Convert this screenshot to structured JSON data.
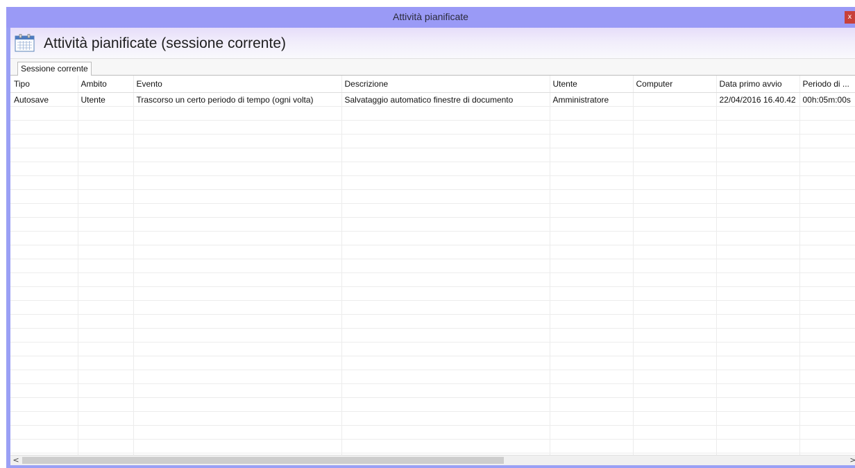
{
  "window": {
    "title": "Attività pianificate",
    "close_label": "x"
  },
  "header": {
    "icon": "calendar-icon",
    "title": "Attività pianificate (sessione corrente)"
  },
  "tabs": [
    {
      "label": "Sessione corrente",
      "selected": true
    }
  ],
  "table": {
    "columns": [
      "Tipo",
      "Ambito",
      "Evento",
      "Descrizione",
      "Utente",
      "Computer",
      "Data primo avvio",
      "Periodo di ..."
    ],
    "rows": [
      [
        "Autosave",
        "Utente",
        "Trascorso un certo periodo di tempo (ogni volta)",
        "Salvataggio automatico finestre di documento",
        "Amministratore",
        "",
        "22/04/2016 16.40.42",
        "00h:05m:00s"
      ]
    ]
  },
  "scrollbar": {
    "left_arrow": "<",
    "right_arrow": ">"
  }
}
